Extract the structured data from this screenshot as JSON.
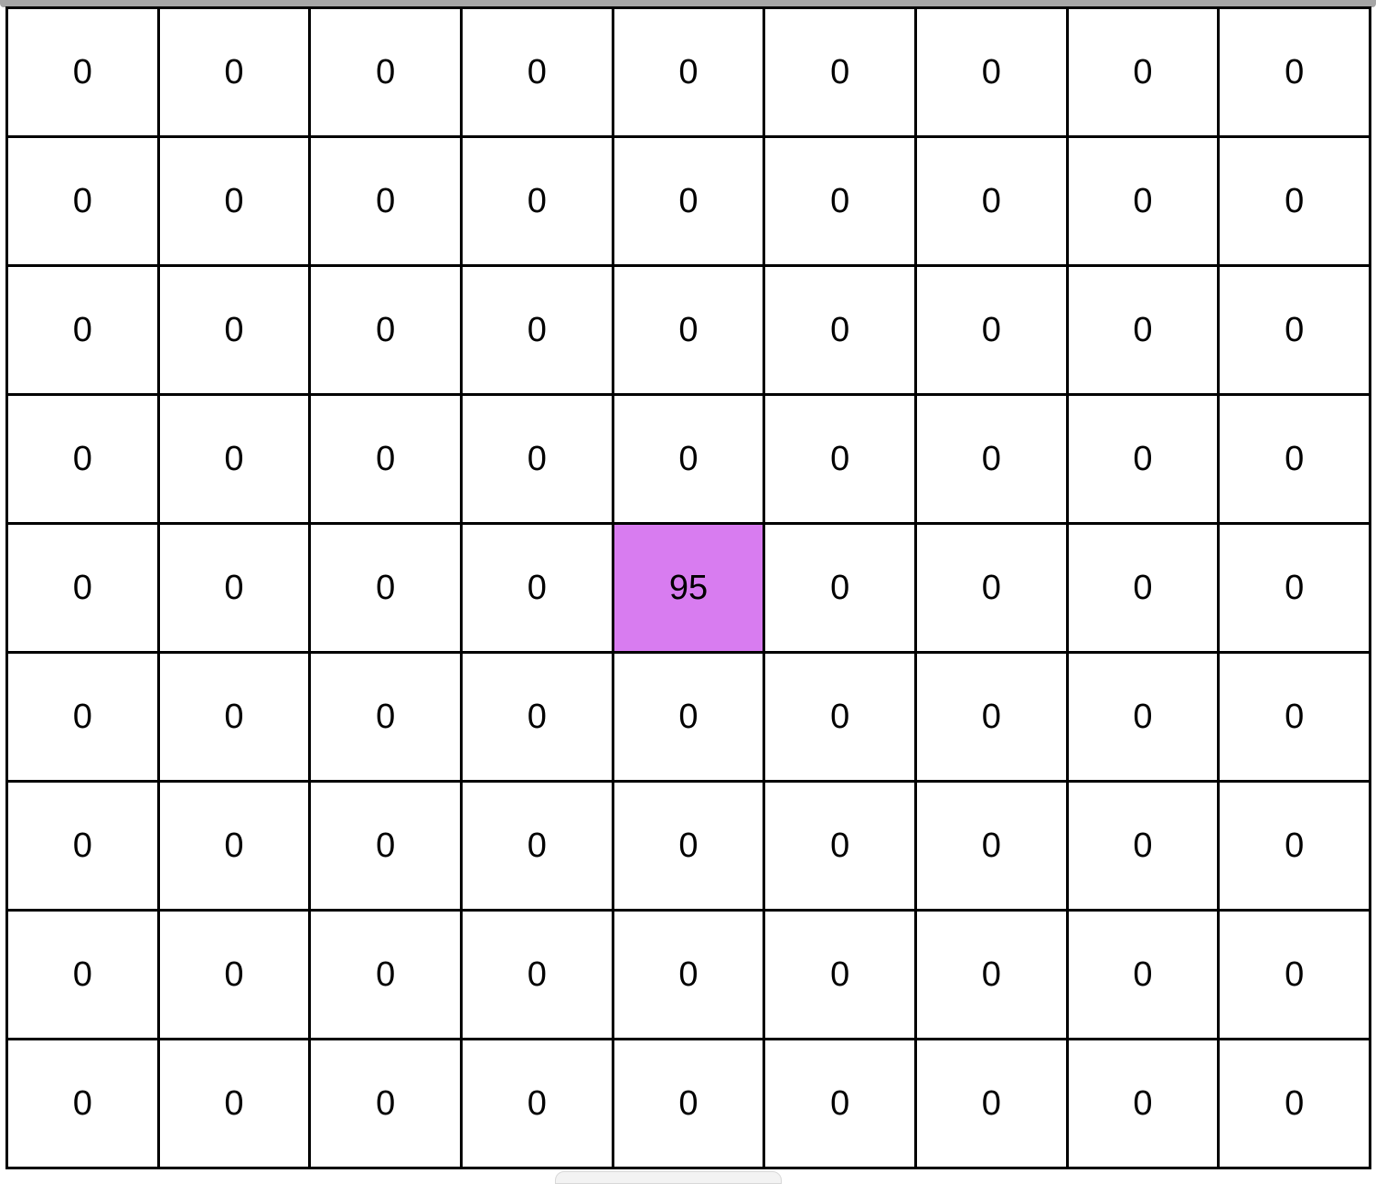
{
  "grid": {
    "rows": 9,
    "cols": 9,
    "cells": [
      [
        "0",
        "0",
        "0",
        "0",
        "0",
        "0",
        "0",
        "0",
        "0"
      ],
      [
        "0",
        "0",
        "0",
        "0",
        "0",
        "0",
        "0",
        "0",
        "0"
      ],
      [
        "0",
        "0",
        "0",
        "0",
        "0",
        "0",
        "0",
        "0",
        "0"
      ],
      [
        "0",
        "0",
        "0",
        "0",
        "0",
        "0",
        "0",
        "0",
        "0"
      ],
      [
        "0",
        "0",
        "0",
        "0",
        "95",
        "0",
        "0",
        "0",
        "0"
      ],
      [
        "0",
        "0",
        "0",
        "0",
        "0",
        "0",
        "0",
        "0",
        "0"
      ],
      [
        "0",
        "0",
        "0",
        "0",
        "0",
        "0",
        "0",
        "0",
        "0"
      ],
      [
        "0",
        "0",
        "0",
        "0",
        "0",
        "0",
        "0",
        "0",
        "0"
      ],
      [
        "0",
        "0",
        "0",
        "0",
        "0",
        "0",
        "0",
        "0",
        "0"
      ]
    ],
    "highlight": {
      "row": 4,
      "col": 4,
      "color": "#d87cf0"
    },
    "cell_background": "#ffffff",
    "line_color": "#000000"
  }
}
